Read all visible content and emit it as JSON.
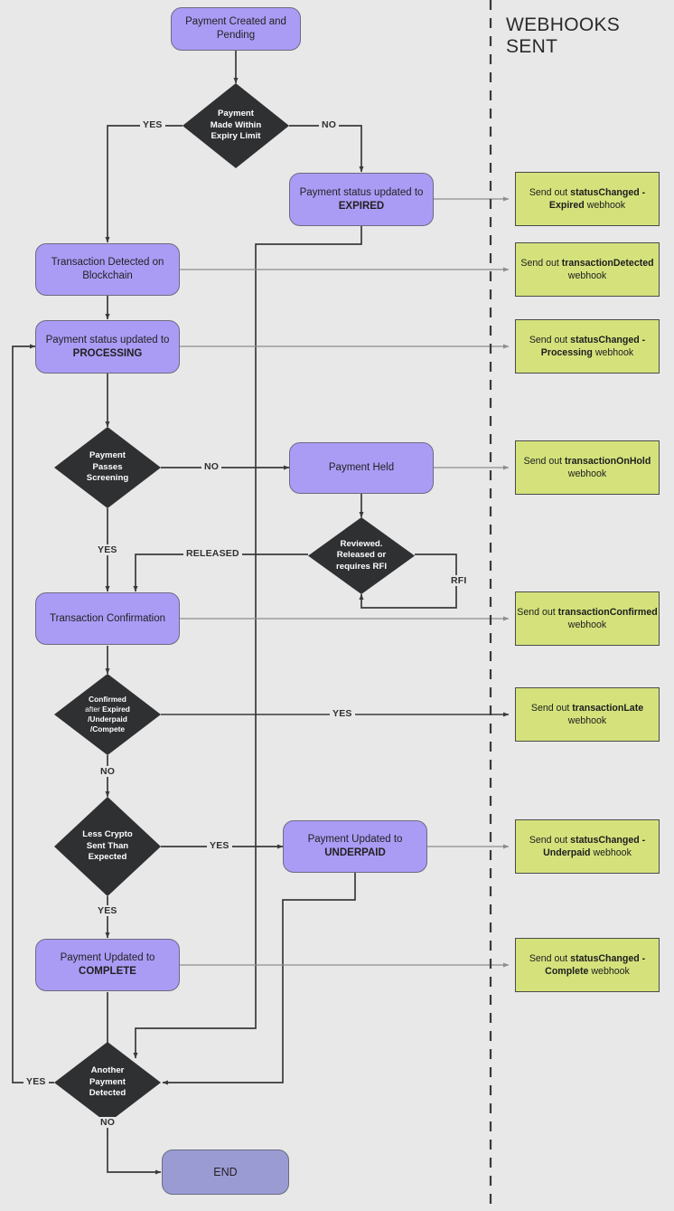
{
  "header": {
    "section_title": "WEBHOOKS SENT"
  },
  "colors": {
    "background": "#e8e8e8",
    "process_fill": "#aa9cf5",
    "end_fill": "#9b9bd4",
    "decision_fill": "#2f3032",
    "webhook_fill": "#d5e27c",
    "edge": "#3a3a3a"
  },
  "nodes": {
    "start": "Payment Created and Pending",
    "expiry_check_l1": "Payment",
    "expiry_check_l2": "Made Within",
    "expiry_check_l3": "Expiry Limit",
    "expired_l1": "Payment status updated to",
    "expired_l2": "EXPIRED",
    "tx_detected": "Transaction Detected on Blockchain",
    "processing_l1": "Payment status updated to",
    "processing_l2": "PROCESSING",
    "screening_l1": "Payment",
    "screening_l2": "Passes",
    "screening_l3": "Screening",
    "payment_held": "Payment Held",
    "reviewed_l1": "Reviewed.",
    "reviewed_l2": "Released or",
    "reviewed_l3": "requires RFI",
    "tx_confirmation": "Transaction Confirmation",
    "confirmed_after_l1": "Confirmed",
    "confirmed_after_l2a": "after ",
    "confirmed_after_l2b": "Expired",
    "confirmed_after_l3": "/Underpaid",
    "confirmed_after_l4": "/Compete",
    "less_crypto_l1": "Less Crypto",
    "less_crypto_l2": "Sent Than",
    "less_crypto_l3": "Expected",
    "underpaid_l1": "Payment Updated to",
    "underpaid_l2": "UNDERPAID",
    "complete_l1": "Payment Updated to",
    "complete_l2": "COMPLETE",
    "another_payment_l1": "Another",
    "another_payment_l2": "Payment",
    "another_payment_l3": "Detected",
    "end": "END"
  },
  "webhooks": [
    {
      "id": "expired",
      "pre": "Send out ",
      "bold": "statusChanged - Expired",
      "post": " webhook"
    },
    {
      "id": "transaction_detected",
      "pre": "Send out ",
      "bold": "transactionDetected",
      "post": " webhook"
    },
    {
      "id": "processing",
      "pre": "Send out ",
      "bold": "statusChanged - Processing",
      "post": " webhook"
    },
    {
      "id": "transaction_onhold",
      "pre": "Send out ",
      "bold": "transactionOnHold",
      "post": " webhook"
    },
    {
      "id": "transaction_confirmed",
      "pre": "Send out ",
      "bold": "transactionConfirmed",
      "post": " webhook"
    },
    {
      "id": "transaction_late",
      "pre": "Send out ",
      "bold": "transactionLate",
      "post": " webhook"
    },
    {
      "id": "underpaid",
      "pre": "Send out ",
      "bold": "statusChanged - Underpaid",
      "post": " webhook"
    },
    {
      "id": "complete",
      "pre": "Send out ",
      "bold": "statusChanged - Complete",
      "post": " webhook"
    }
  ],
  "edge_labels": {
    "expiry_yes": "YES",
    "expiry_no": "NO",
    "screening_no": "NO",
    "screening_yes": "YES",
    "released": "RELEASED",
    "rfi": "RFI",
    "confirmed_yes": "YES",
    "confirmed_no": "NO",
    "less_crypto_yes_right": "YES",
    "less_crypto_yes_down": "YES",
    "another_yes": "YES",
    "another_no": "NO"
  }
}
